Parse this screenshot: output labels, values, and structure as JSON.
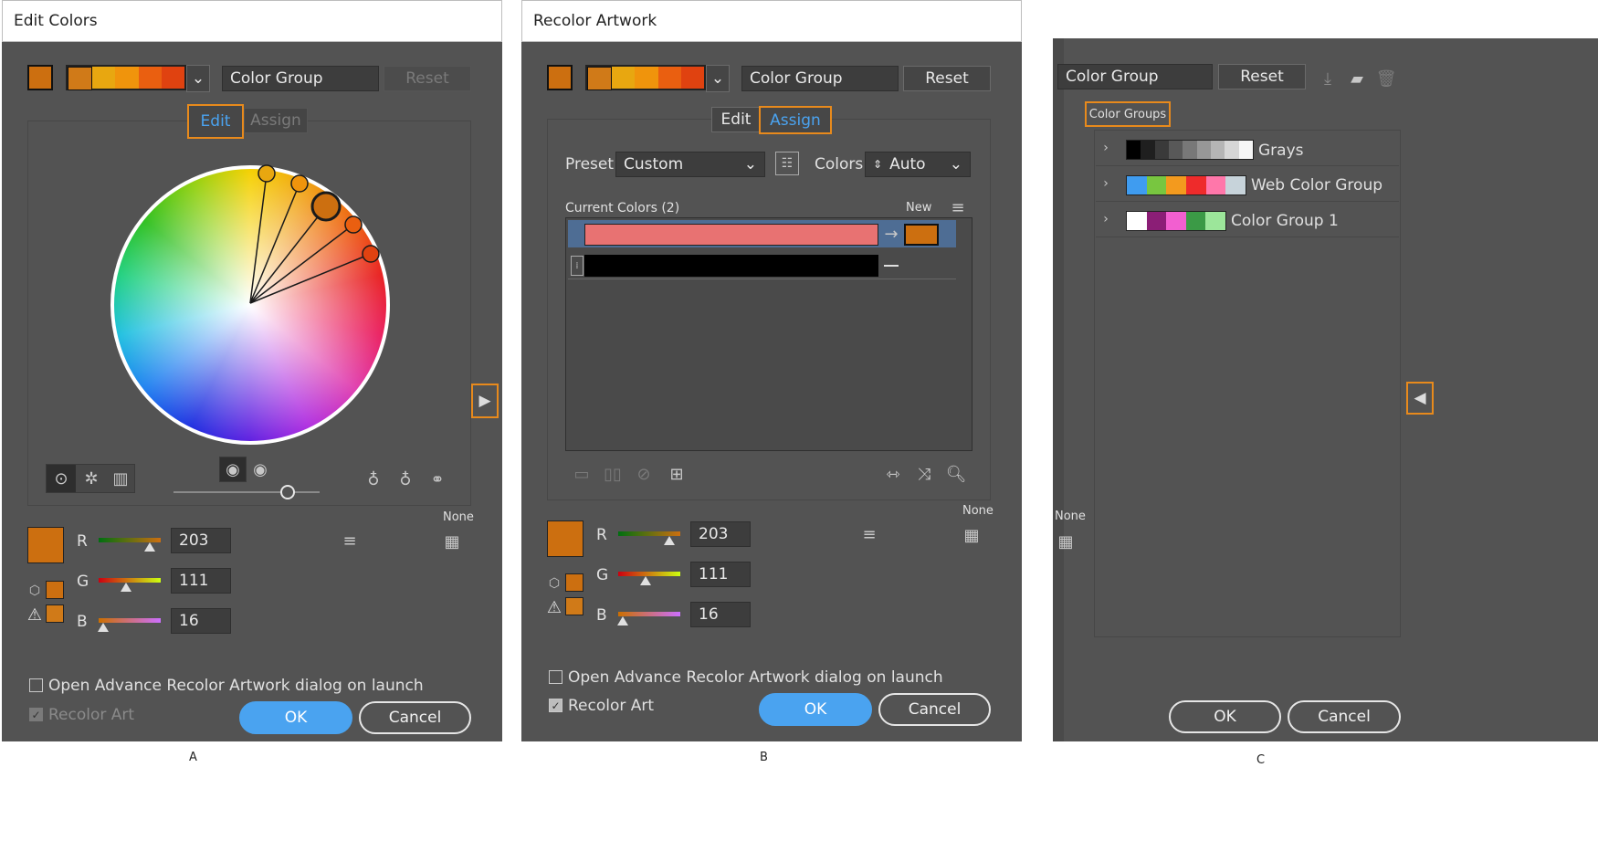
{
  "colors": {
    "accent": "#e88a1c",
    "base_swatch": "#cc6f10",
    "ok_blue": "#4aa3f0",
    "current_color_1": "#e87272",
    "current_color_2": "#000000"
  },
  "group_swatches": [
    "#d07a18",
    "#e8a710",
    "#f0940c",
    "#ea5f10",
    "#e04210"
  ],
  "panel_a": {
    "title": "Edit Colors",
    "group_name": "Color Group",
    "reset": "Reset",
    "tab_edit": "Edit",
    "tab_assign": "Assign",
    "channels": [
      {
        "label": "R",
        "value": "203",
        "slider": 0.8
      },
      {
        "label": "G",
        "value": "111",
        "slider": 0.44
      },
      {
        "label": "B",
        "value": "16",
        "slider": 0.07
      }
    ],
    "none_label": "None",
    "checkbox_open": "Open Advance Recolor Artwork dialog on launch",
    "checkbox_recolor": "Recolor Art",
    "ok": "OK",
    "cancel": "Cancel",
    "caption": "A"
  },
  "panel_b": {
    "title": "Recolor Artwork",
    "group_name": "Color Group",
    "reset": "Reset",
    "tab_edit": "Edit",
    "tab_assign": "Assign",
    "preset_label": "Preset:",
    "preset_value": "Custom",
    "colors_label": "Colors:",
    "colors_value": "Auto",
    "current_colors": "Current Colors (2)",
    "new_label": "New",
    "channels": [
      {
        "label": "R",
        "value": "203",
        "slider": 0.8
      },
      {
        "label": "G",
        "value": "111",
        "slider": 0.44
      },
      {
        "label": "B",
        "value": "16",
        "slider": 0.07
      }
    ],
    "none_label": "None",
    "checkbox_open": "Open Advance Recolor Artwork dialog on launch",
    "checkbox_recolor": "Recolor Art",
    "ok": "OK",
    "cancel": "Cancel",
    "caption": "B"
  },
  "panel_c": {
    "group_name": "Color Group",
    "reset": "Reset",
    "section_title": "Color Groups",
    "groups": [
      {
        "name": "Grays",
        "swatches": [
          "#000000",
          "#1f1f1f",
          "#3a3a3a",
          "#585858",
          "#787878",
          "#979797",
          "#b5b5b5",
          "#d6d6d6",
          "#f6f6f6"
        ]
      },
      {
        "name": "Web Color Group",
        "swatches": [
          "#3f9cf0",
          "#78c640",
          "#f39a1e",
          "#ee2b2b",
          "#ff77aa",
          "#c7d3da"
        ]
      },
      {
        "name": "Color Group 1",
        "swatches": [
          "#ffffff",
          "#8b1e76",
          "#f25fd0",
          "#3b9a46",
          "#9ce69a"
        ]
      }
    ],
    "none_label": "None",
    "ok": "OK",
    "cancel": "Cancel",
    "caption": "C"
  }
}
